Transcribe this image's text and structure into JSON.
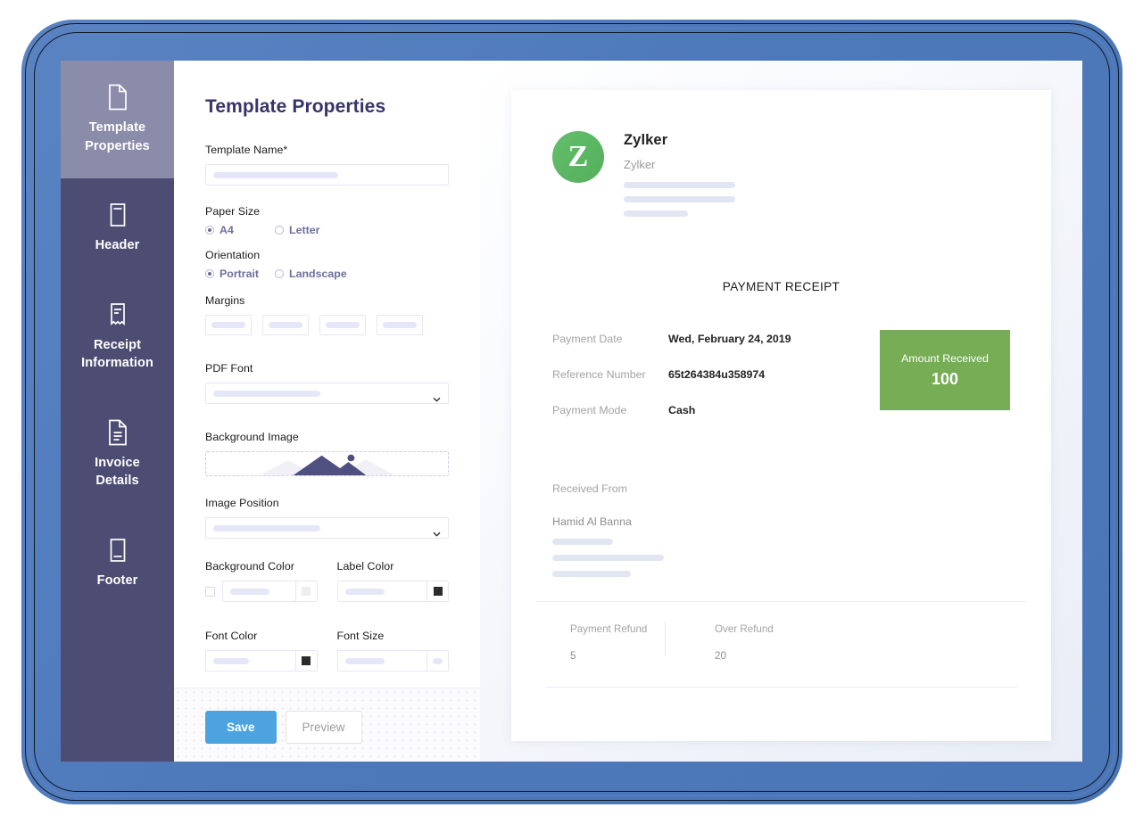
{
  "sidebar": {
    "items": [
      {
        "label": "Template\nProperties",
        "icon": "document-icon",
        "active": true
      },
      {
        "label": "Header",
        "icon": "header-block-icon",
        "active": false
      },
      {
        "label": "Receipt\nInformation",
        "icon": "receipt-icon",
        "active": false
      },
      {
        "label": "Invoice\nDetails",
        "icon": "invoice-document-icon",
        "active": false
      },
      {
        "label": "Footer",
        "icon": "footer-block-icon",
        "active": false
      }
    ]
  },
  "form": {
    "title": "Template Properties",
    "template_name": {
      "label": "Template Name*",
      "value": ""
    },
    "paper_size": {
      "label": "Paper Size",
      "options": [
        {
          "label": "A4",
          "selected": true
        },
        {
          "label": "Letter",
          "selected": false
        }
      ]
    },
    "orientation": {
      "label": "Orientation",
      "options": [
        {
          "label": "Portrait",
          "selected": true
        },
        {
          "label": "Landscape",
          "selected": false
        }
      ]
    },
    "margins": {
      "label": "Margins",
      "values": [
        "",
        "",
        "",
        ""
      ]
    },
    "pdf_font": {
      "label": "PDF Font",
      "value": ""
    },
    "background_image": {
      "label": "Background Image"
    },
    "image_position": {
      "label": "Image Position",
      "value": ""
    },
    "background_color": {
      "label": "Background Color",
      "value": "",
      "swatch": "#eeeeee",
      "checkbox_checked": false
    },
    "label_color": {
      "label": "Label Color",
      "value": "",
      "swatch": "#2b2b2b"
    },
    "font_color": {
      "label": "Font Color",
      "value": "",
      "swatch": "#2b2b2b"
    },
    "font_size": {
      "label": "Font Size",
      "value": ""
    },
    "save_label": "Save",
    "preview_label": "Preview"
  },
  "receipt": {
    "logo_letter": "Z",
    "company_name": "Zylker",
    "company_sub": "Zylker",
    "title": "PAYMENT RECEIPT",
    "fields": [
      {
        "label": "Payment Date",
        "value": "Wed, February 24, 2019"
      },
      {
        "label": "Reference Number",
        "value": "65t264384u358974"
      },
      {
        "label": "Payment Mode",
        "value": "Cash"
      }
    ],
    "amount": {
      "label": "Amount Received",
      "value": "100",
      "color": "#76ad55"
    },
    "received_from": {
      "label": "Received From",
      "name": "Hamid Al Banna"
    },
    "refunds": [
      {
        "label": "Payment Refund",
        "value": "5"
      },
      {
        "label": "Over Refund",
        "value": "20"
      }
    ]
  },
  "theme": {
    "frame_color": "#4d79bb",
    "sidebar_color": "#4d4d74",
    "sidebar_active_color": "#8b8baa",
    "accent_blue": "#4ca3e0",
    "title_color": "#36356b"
  }
}
